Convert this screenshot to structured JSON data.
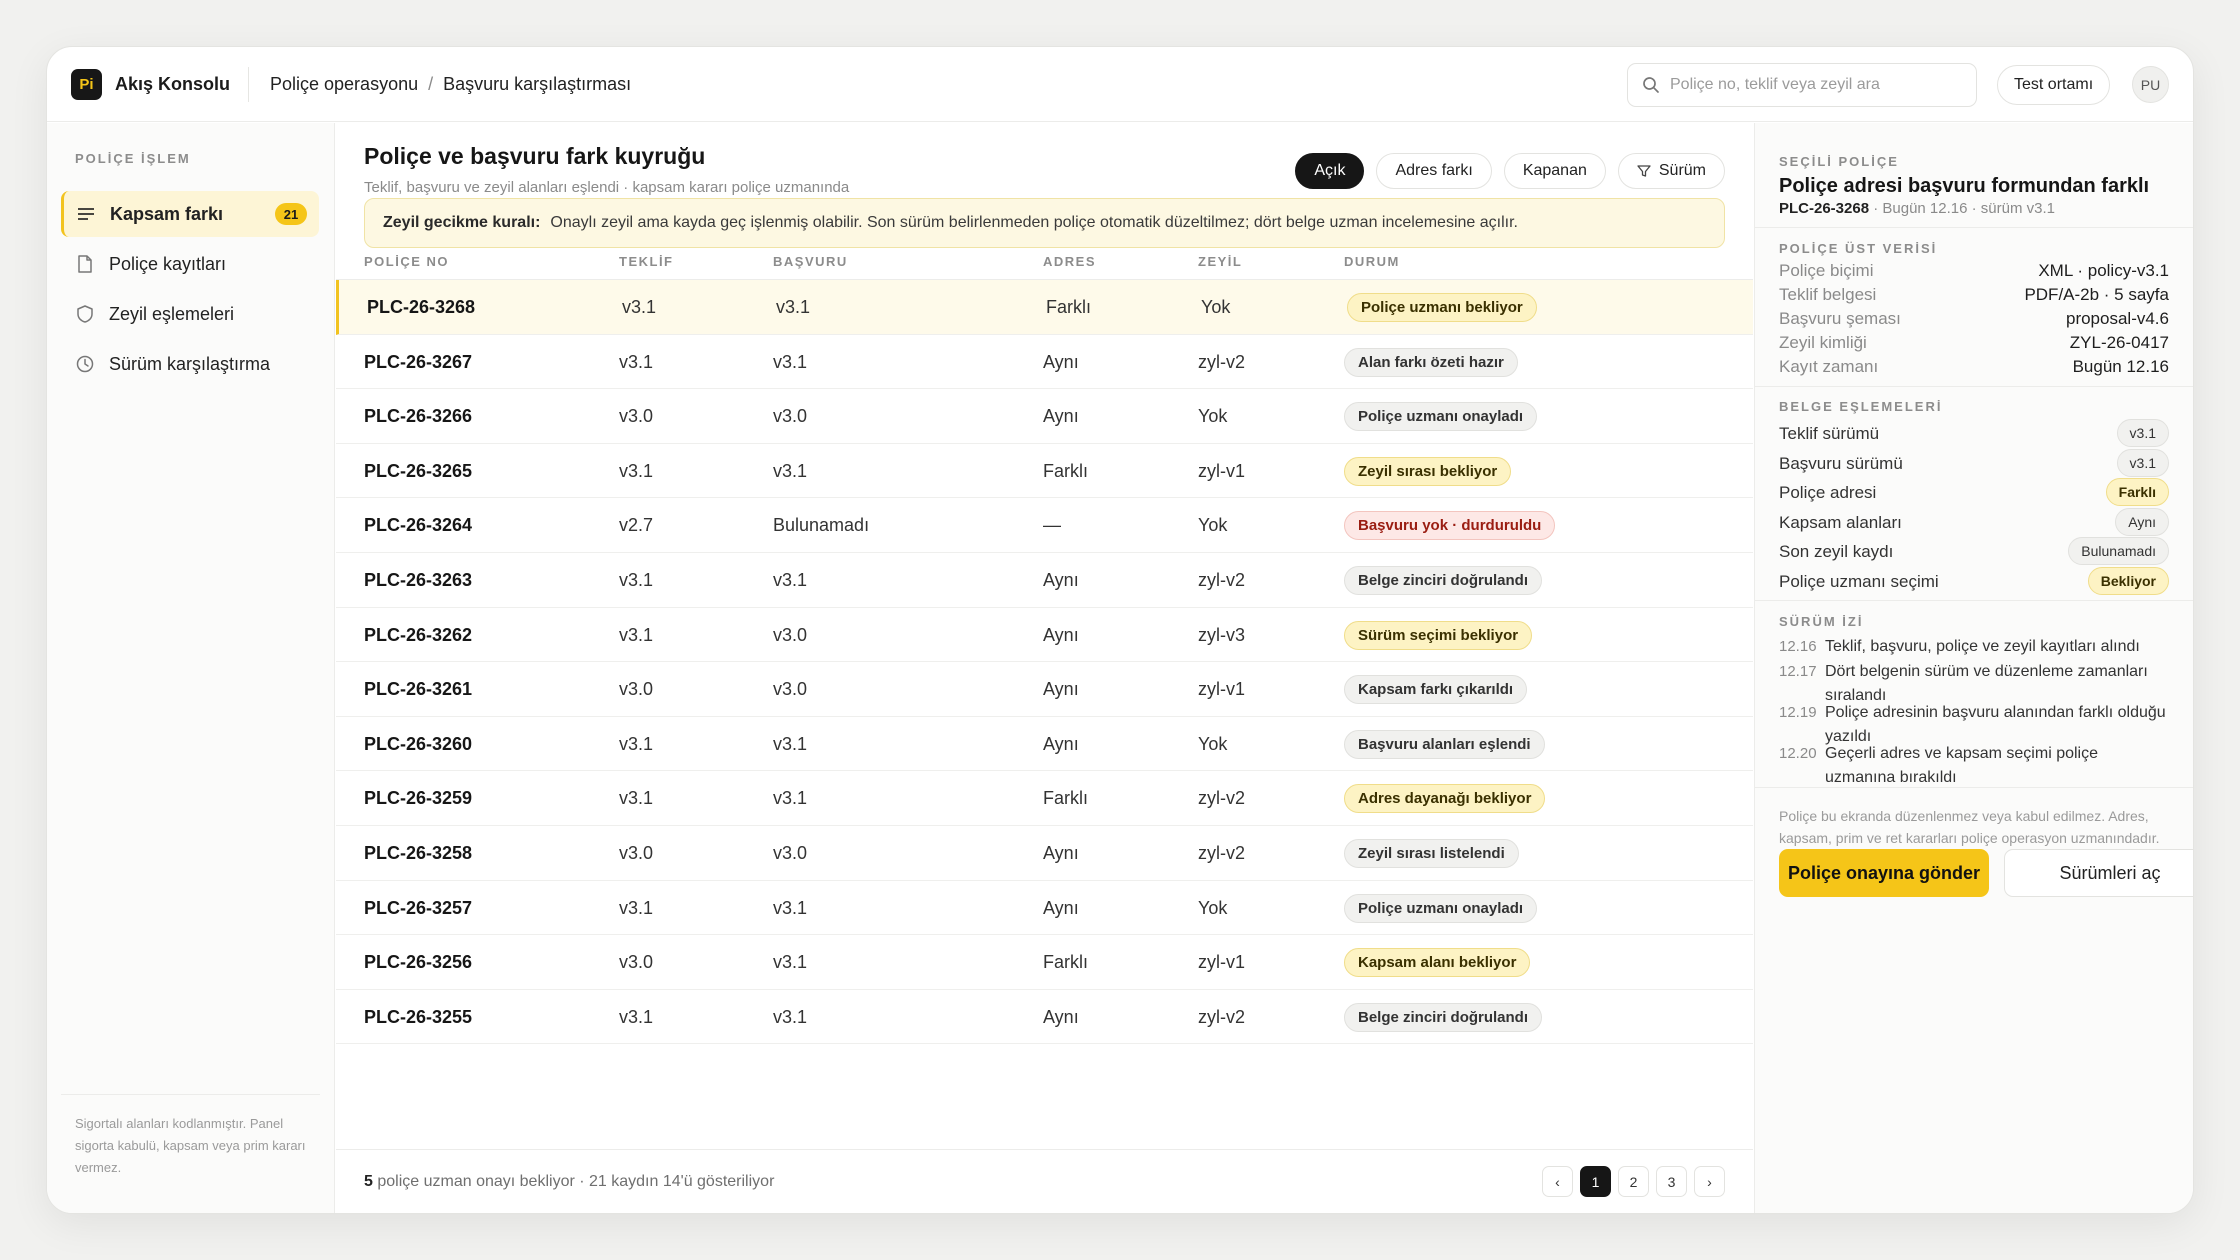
{
  "app": {
    "logo_text": "Pi",
    "name": "Akış Konsolu"
  },
  "breadcrumb": {
    "first": "Poliçe operasyonu",
    "separator": "/",
    "second": "Başvuru karşılaştırması"
  },
  "search": {
    "placeholder": "Poliçe no, teklif veya zeyil ara"
  },
  "env_button": "Test ortamı",
  "user_initials": "PU",
  "sidebar": {
    "heading": "POLİÇE İŞLEM",
    "items": [
      {
        "label": "Kapsam farkı",
        "badge": "21",
        "icon": "list-icon"
      },
      {
        "label": "Poliçe kayıtları",
        "icon": "document-icon"
      },
      {
        "label": "Zeyil eşlemeleri",
        "icon": "shield-icon"
      },
      {
        "label": "Sürüm karşılaştırma",
        "icon": "clock-icon"
      }
    ],
    "note": "Sigortalı alanları kodlanmıştır. Panel sigorta kabulü, kapsam veya prim kararı vermez."
  },
  "main": {
    "title": "Poliçe ve başvuru fark kuyruğu",
    "subtitle": "Teklif, başvuru ve zeyil alanları eşlendi · kapsam kararı poliçe uzmanında",
    "filters": [
      "Açık",
      "Adres farkı",
      "Kapanan",
      "Sürüm"
    ],
    "notice_label": "Zeyil gecikme kuralı:",
    "notice_text": "Onaylı zeyil ama kayda geç işlenmiş olabilir. Son sürüm belirlenmeden poliçe otomatik düzeltilmez; dört belge uzman incelemesine açılır.",
    "columns": [
      "POLİÇE NO",
      "TEKLİF",
      "BAŞVURU",
      "ADRES",
      "ZEYİL",
      "DURUM"
    ],
    "rows": [
      {
        "id": "PLC-26-3268",
        "teklif": "v3.1",
        "basvuru": "v3.1",
        "adres": "Farklı",
        "zeyil": "Yok",
        "durum": "Poliçe uzmanı bekliyor",
        "tone": "amber"
      },
      {
        "id": "PLC-26-3267",
        "teklif": "v3.1",
        "basvuru": "v3.1",
        "adres": "Aynı",
        "zeyil": "zyl-v2",
        "durum": "Alan farkı özeti hazır",
        "tone": "gray"
      },
      {
        "id": "PLC-26-3266",
        "teklif": "v3.0",
        "basvuru": "v3.0",
        "adres": "Aynı",
        "zeyil": "Yok",
        "durum": "Poliçe uzmanı onayladı",
        "tone": "gray"
      },
      {
        "id": "PLC-26-3265",
        "teklif": "v3.1",
        "basvuru": "v3.1",
        "adres": "Farklı",
        "zeyil": "zyl-v1",
        "durum": "Zeyil sırası bekliyor",
        "tone": "amber"
      },
      {
        "id": "PLC-26-3264",
        "teklif": "v2.7",
        "basvuru": "Bulunamadı",
        "adres": "—",
        "zeyil": "Yok",
        "durum": "Başvuru yok · durduruldu",
        "tone": "red"
      },
      {
        "id": "PLC-26-3263",
        "teklif": "v3.1",
        "basvuru": "v3.1",
        "adres": "Aynı",
        "zeyil": "zyl-v2",
        "durum": "Belge zinciri doğrulandı",
        "tone": "gray"
      },
      {
        "id": "PLC-26-3262",
        "teklif": "v3.1",
        "basvuru": "v3.0",
        "adres": "Aynı",
        "zeyil": "zyl-v3",
        "durum": "Sürüm seçimi bekliyor",
        "tone": "amber"
      },
      {
        "id": "PLC-26-3261",
        "teklif": "v3.0",
        "basvuru": "v3.0",
        "adres": "Aynı",
        "zeyil": "zyl-v1",
        "durum": "Kapsam farkı çıkarıldı",
        "tone": "gray"
      },
      {
        "id": "PLC-26-3260",
        "teklif": "v3.1",
        "basvuru": "v3.1",
        "adres": "Aynı",
        "zeyil": "Yok",
        "durum": "Başvuru alanları eşlendi",
        "tone": "gray"
      },
      {
        "id": "PLC-26-3259",
        "teklif": "v3.1",
        "basvuru": "v3.1",
        "adres": "Farklı",
        "zeyil": "zyl-v2",
        "durum": "Adres dayanağı bekliyor",
        "tone": "amber"
      },
      {
        "id": "PLC-26-3258",
        "teklif": "v3.0",
        "basvuru": "v3.0",
        "adres": "Aynı",
        "zeyil": "zyl-v2",
        "durum": "Zeyil sırası listelendi",
        "tone": "gray"
      },
      {
        "id": "PLC-26-3257",
        "teklif": "v3.1",
        "basvuru": "v3.1",
        "adres": "Aynı",
        "zeyil": "Yok",
        "durum": "Poliçe uzmanı onayladı",
        "tone": "gray"
      },
      {
        "id": "PLC-26-3256",
        "teklif": "v3.0",
        "basvuru": "v3.1",
        "adres": "Farklı",
        "zeyil": "zyl-v1",
        "durum": "Kapsam alanı bekliyor",
        "tone": "amber"
      },
      {
        "id": "PLC-26-3255",
        "teklif": "v3.1",
        "basvuru": "v3.1",
        "adres": "Aynı",
        "zeyil": "zyl-v2",
        "durum": "Belge zinciri doğrulandı",
        "tone": "gray"
      }
    ],
    "footer_count": "5",
    "footer_text": " poliçe uzman onayı bekliyor · 21 kaydın 14'ü gösteriliyor",
    "pages": [
      "1",
      "2",
      "3"
    ],
    "prev": "‹",
    "next": "›"
  },
  "panel": {
    "label": "SEÇİLİ POLİÇE",
    "title": "Poliçe adresi başvuru formundan farklı",
    "policy_id": "PLC-26-3268",
    "meta": " · Bugün 12.16 · sürüm v3.1",
    "meta_heading": "POLİÇE ÜST VERİSİ",
    "meta_rows": [
      {
        "k": "Poliçe biçimi",
        "v": "XML · policy-v3.1"
      },
      {
        "k": "Teklif belgesi",
        "v": "PDF/A-2b · 5 sayfa"
      },
      {
        "k": "Başvuru şeması",
        "v": "proposal-v4.6"
      },
      {
        "k": "Zeyil kimliği",
        "v": "ZYL-26-0417"
      },
      {
        "k": "Kayıt zamanı",
        "v": "Bugün 12.16"
      }
    ],
    "map_heading": "BELGE EŞLEMELERİ",
    "map_rows": [
      {
        "k": "Teklif sürümü",
        "v": "v3.1",
        "tone": "gray"
      },
      {
        "k": "Başvuru sürümü",
        "v": "v3.1",
        "tone": "gray"
      },
      {
        "k": "Poliçe adresi",
        "v": "Farklı",
        "tone": "amber"
      },
      {
        "k": "Kapsam alanları",
        "v": "Aynı",
        "tone": "gray"
      },
      {
        "k": "Son zeyil kaydı",
        "v": "Bulunamadı",
        "tone": "gray"
      },
      {
        "k": "Poliçe uzmanı seçimi",
        "v": "Bekliyor",
        "tone": "amber"
      }
    ],
    "log_heading": "SÜRÜM İZİ",
    "log": [
      {
        "t": "12.16",
        "text": "Teklif, başvuru, poliçe ve zeyil kayıtları alındı"
      },
      {
        "t": "12.17",
        "text": "Dört belgenin sürüm ve düzenleme zamanları sıralandı"
      },
      {
        "t": "12.19",
        "text": "Poliçe adresinin başvuru alanından farklı olduğu yazıldı"
      },
      {
        "t": "12.20",
        "text": "Geçerli adres ve kapsam seçimi poliçe uzmanına bırakıldı"
      }
    ],
    "note": "Poliçe bu ekranda düzenlenmez veya kabul edilmez. Adres, kapsam, prim ve ret kararları poliçe operasyon uzmanındadır.",
    "primary_button": "Poliçe onayına gönder",
    "secondary_button": "Sürümleri aç"
  },
  "colors": {
    "accent": "#f5c518",
    "dark": "#161616",
    "danger": "#9a1d12"
  }
}
